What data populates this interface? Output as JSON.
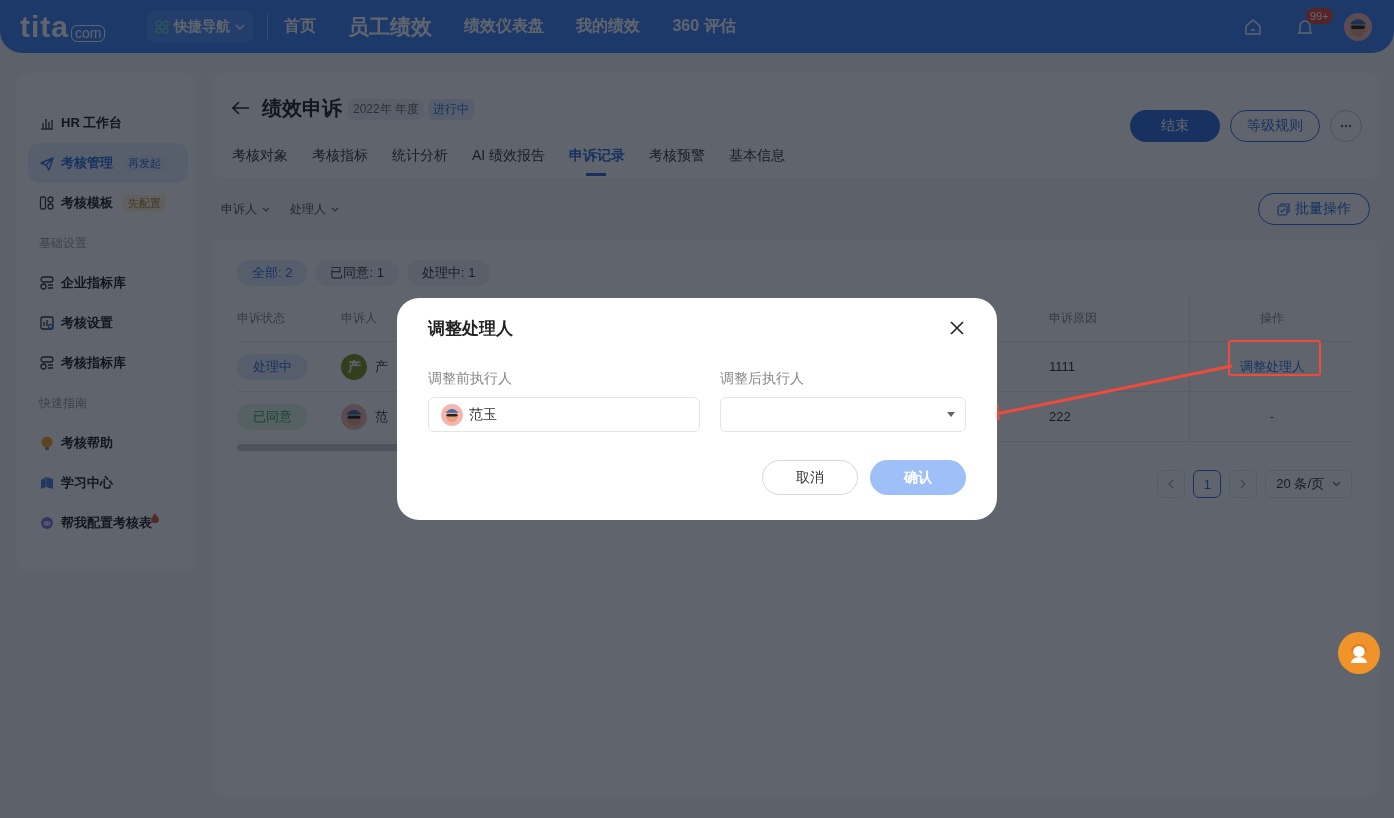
{
  "topbar": {
    "logo": "tita",
    "logo_suffix": "com",
    "quick_nav": "快捷导航",
    "nav": [
      {
        "label": "首页",
        "selected": false
      },
      {
        "label": "员工绩效",
        "selected": true
      },
      {
        "label": "绩效仪表盘",
        "selected": false
      },
      {
        "label": "我的绩效",
        "selected": false
      },
      {
        "label": "360 评估",
        "selected": false
      }
    ],
    "badge": "99+"
  },
  "sidebar": {
    "items": [
      {
        "kind": "item",
        "label": "HR 工作台",
        "selected": false
      },
      {
        "kind": "item",
        "label": "考核管理",
        "tag": {
          "label": "再发起",
          "kind": "info"
        },
        "selected": true
      },
      {
        "kind": "item",
        "label": "考核模板",
        "tag": {
          "label": "先配置",
          "kind": "warning"
        },
        "selected": false
      },
      {
        "kind": "section",
        "label": "基础设置"
      },
      {
        "kind": "item",
        "label": "企业指标库",
        "selected": false
      },
      {
        "kind": "item",
        "label": "考核设置",
        "selected": false
      },
      {
        "kind": "item",
        "label": "考核指标库",
        "selected": false
      },
      {
        "kind": "section",
        "label": "快速指南"
      },
      {
        "kind": "item",
        "label": "考核帮助",
        "selected": false
      },
      {
        "kind": "item",
        "label": "学习中心",
        "selected": false
      },
      {
        "kind": "item",
        "label": "帮我配置考核表",
        "hot": true,
        "selected": false
      }
    ]
  },
  "page": {
    "title": "绩效申诉",
    "year_tag": "2022年 年度",
    "status_tag": "进行中",
    "tabs": [
      {
        "label": "考核对象",
        "selected": false
      },
      {
        "label": "考核指标",
        "selected": false
      },
      {
        "label": "统计分析",
        "selected": false
      },
      {
        "label": "AI 绩效报告",
        "selected": false
      },
      {
        "label": "申诉记录",
        "selected": true
      },
      {
        "label": "考核预警",
        "selected": false
      },
      {
        "label": "基本信息",
        "selected": false
      }
    ],
    "buttons": [
      {
        "label": "结束",
        "kind": "primary"
      },
      {
        "label": "等级规则",
        "kind": "outline"
      }
    ],
    "filters": [
      "申诉人",
      "处理人"
    ],
    "batch_button": "批量操作"
  },
  "table": {
    "chips": [
      {
        "label": "全部: 2",
        "selected": true
      },
      {
        "label": "已同意: 1",
        "selected": false
      },
      {
        "label": "处理中: 1",
        "selected": false
      }
    ],
    "columns": [
      "申诉状态",
      "申诉人",
      "申诉原因",
      "操作"
    ],
    "rows": [
      {
        "status": {
          "label": "处理中",
          "kind": "processing"
        },
        "avatar": {
          "kind": "letter",
          "text": "产"
        },
        "person": "产",
        "reason": "1111",
        "action": {
          "label": "调整处理人",
          "kind": "link"
        }
      },
      {
        "status": {
          "label": "已同意",
          "kind": "agreed"
        },
        "avatar": {
          "kind": "photo"
        },
        "person": "范",
        "reason": "222",
        "action": {
          "label": "-",
          "kind": "plain"
        }
      }
    ],
    "pagination": {
      "current": "1",
      "page_size": "20 条/页"
    }
  },
  "modal": {
    "title": "调整处理人",
    "fields": [
      {
        "label": "调整前执行人",
        "kind": "person",
        "value": "范玉"
      },
      {
        "label": "调整后执行人",
        "kind": "select"
      }
    ],
    "buttons": [
      {
        "label": "取消",
        "kind": "cancel",
        "disabled": false
      },
      {
        "label": "确认",
        "kind": "confirm",
        "disabled": true
      }
    ]
  }
}
